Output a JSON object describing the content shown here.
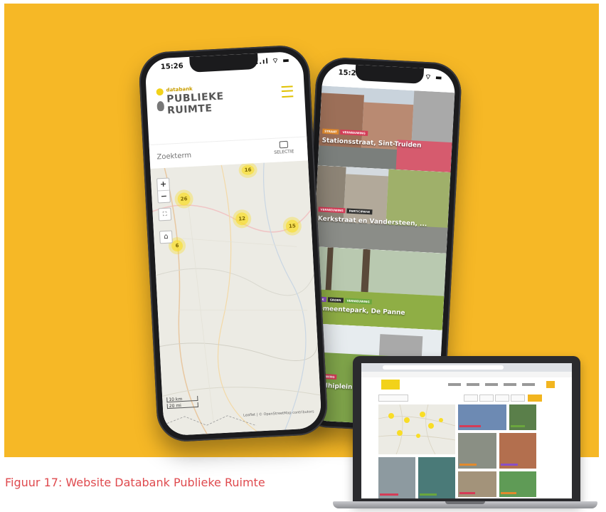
{
  "colors": {
    "background": "#f6b826",
    "caption": "#df4a4e",
    "logo_yellow": "#f2d21a",
    "cluster": "#f9dd26"
  },
  "phone_map": {
    "status_time": "15:26",
    "status_signal": "..ıl ⌔ ▬",
    "logo_small": "databank",
    "logo_line1": "PUBLIEKE",
    "logo_line2": "RUIMTE",
    "search_placeholder": "Zoekterm",
    "filter_label": "SELECTIE",
    "zoom_in": "+",
    "zoom_out": "−",
    "fullscreen_icon": "⛶",
    "home_icon": "⌂",
    "scale_top": "10 km",
    "scale_bottom": "20 mi",
    "attribution": "Leaflet | © OpenStreetMap contributors",
    "clusters": [
      "16",
      "26",
      "12",
      "15",
      "6"
    ]
  },
  "phone_list": {
    "status_time": "15:26",
    "status_signal": "..ıl ⌔ ▬",
    "cards": [
      {
        "title": "Stationsstraat, Sint-Truiden",
        "tags": [
          "STRAAT",
          "VERNIEUWING"
        ]
      },
      {
        "title": "Kerkstraat en Vandersteen, ...",
        "tags": [
          "VERNIEUWING",
          "PARTICIPATIE"
        ]
      },
      {
        "title": "Gemeentepark, De Panne",
        "tags": [
          "PARK",
          "GROEN",
          "VERNIEUWING"
        ]
      },
      {
        "title": "Gandhiplein",
        "tags": [
          "VERNIEUWING"
        ]
      }
    ]
  },
  "caption": "Figuur 17: Website Databank Publieke Ruimte"
}
